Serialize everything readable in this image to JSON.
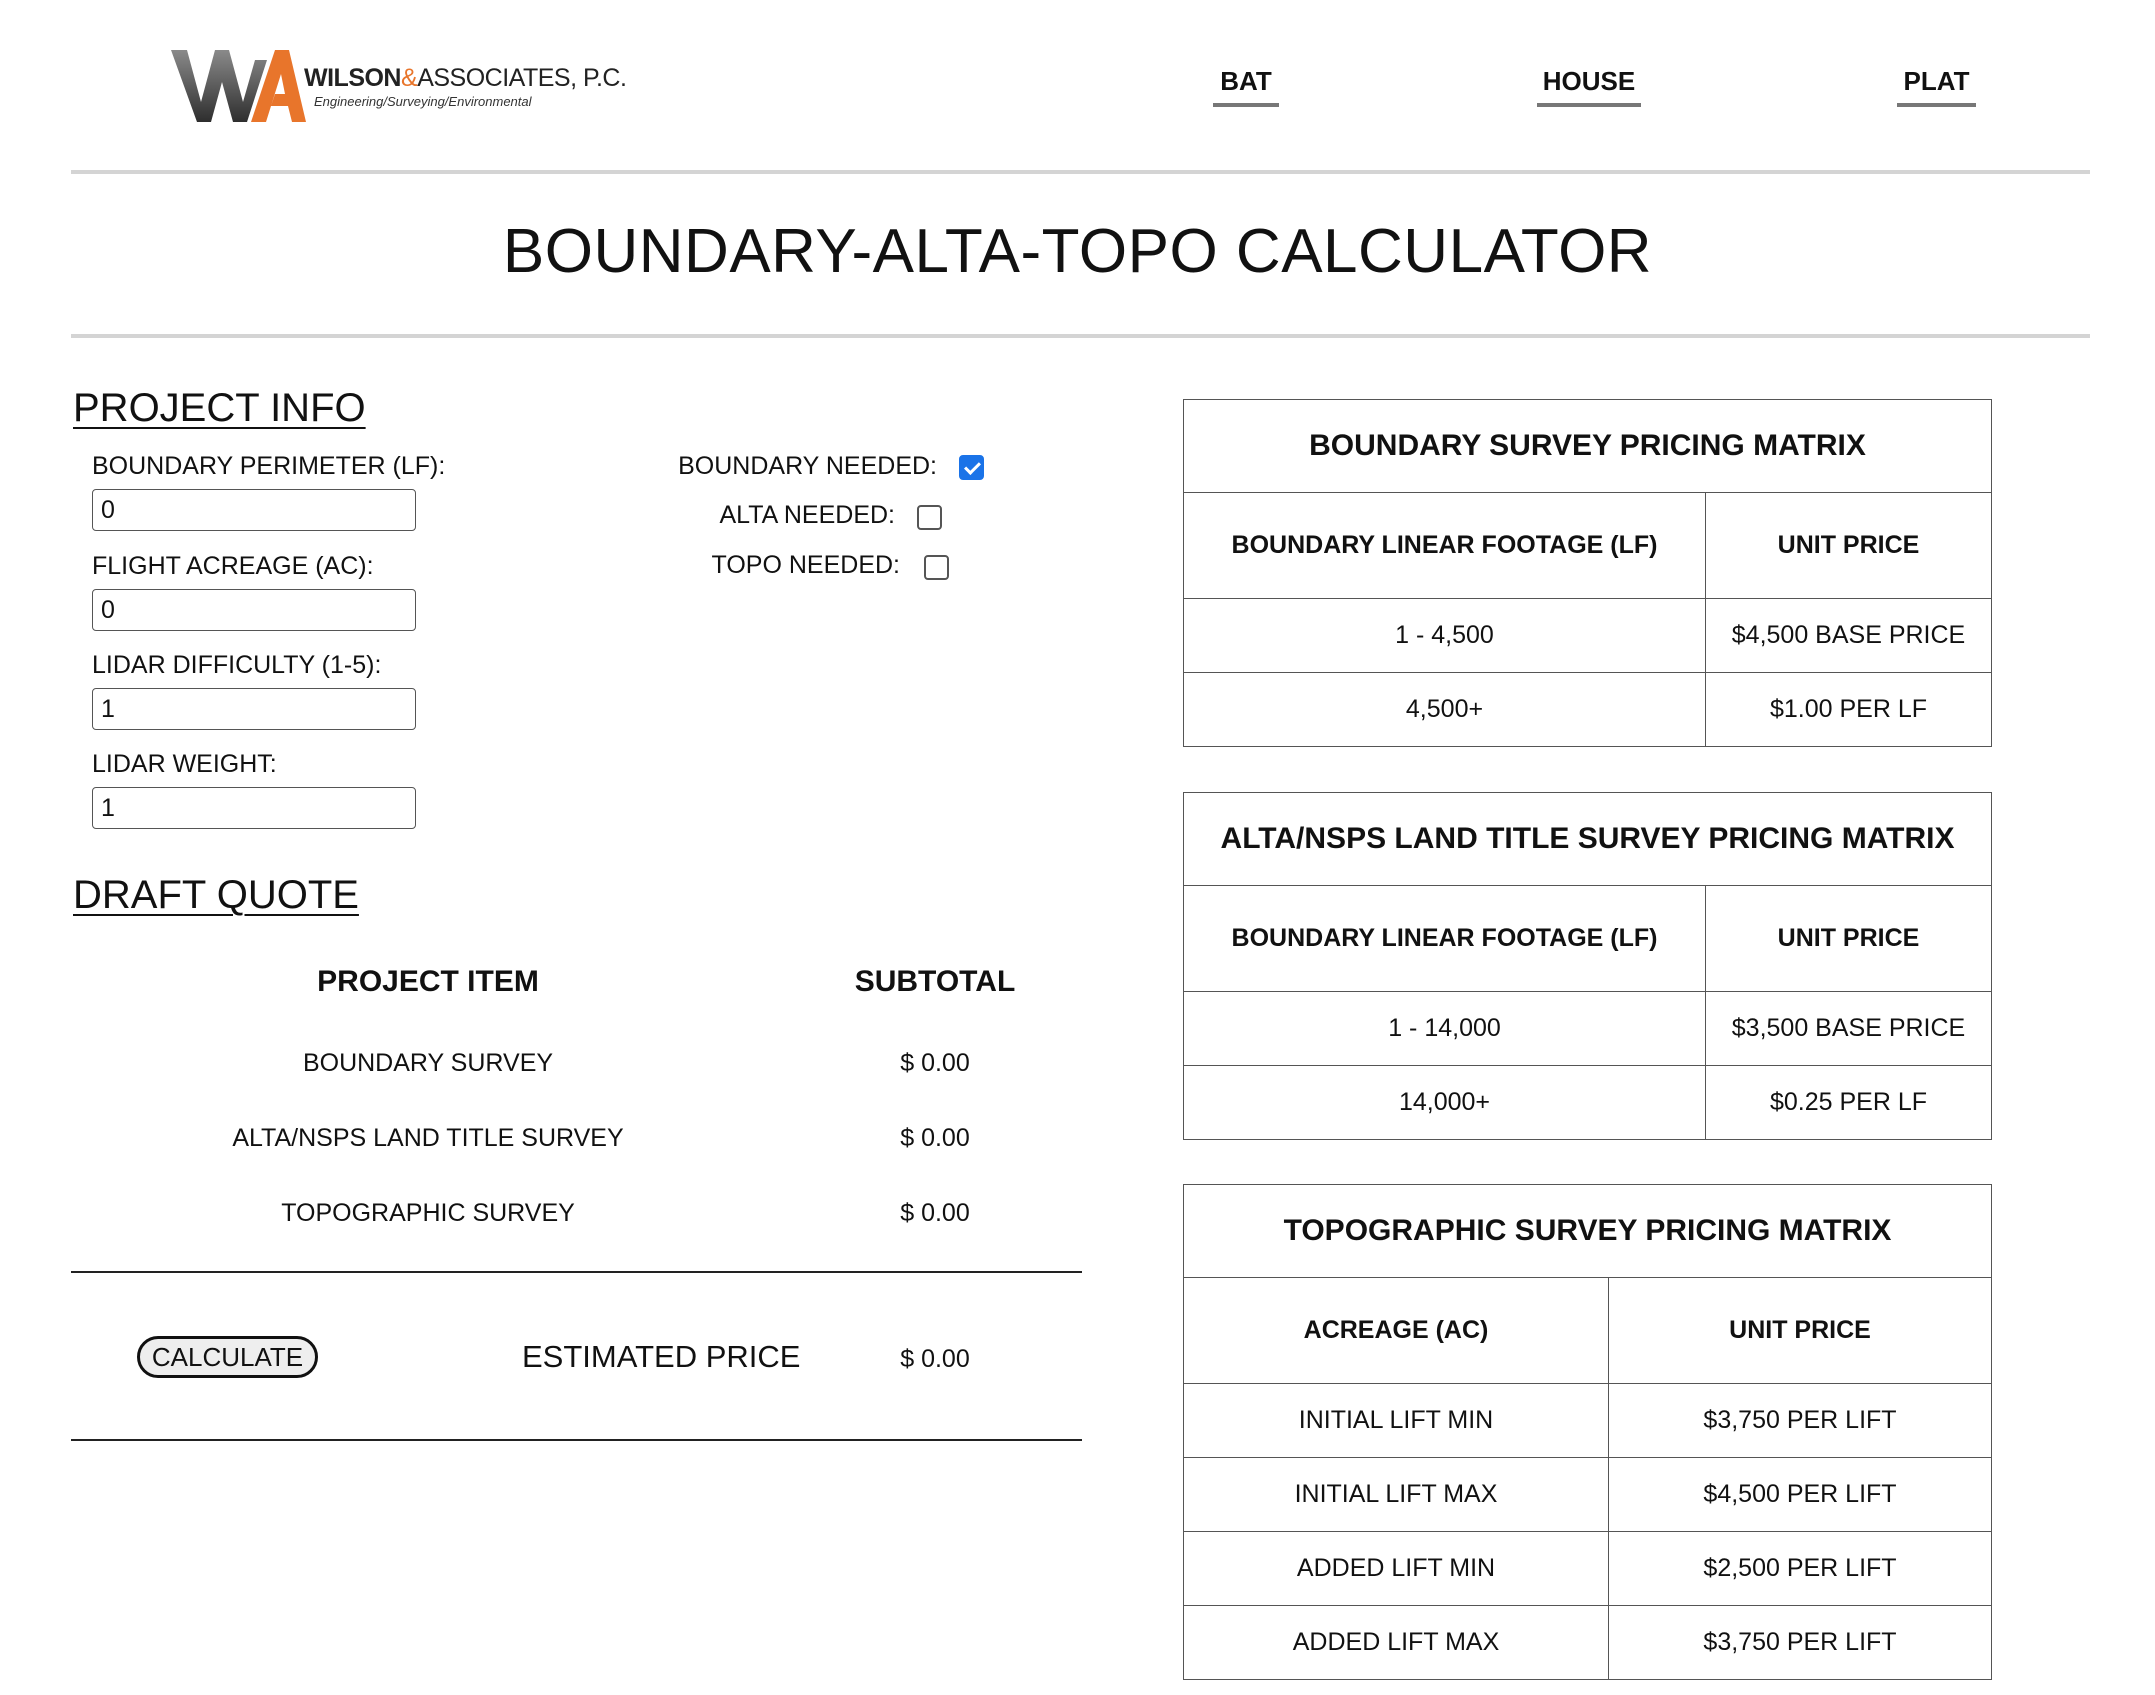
{
  "header": {
    "logo": {
      "name_bold": "WILSON",
      "ampersand": "&",
      "name_rest": "ASSOCIATES, P.C.",
      "tagline": "Engineering/Surveying/Environmental"
    },
    "nav": [
      {
        "label": "BAT"
      },
      {
        "label": "HOUSE"
      },
      {
        "label": "PLAT"
      }
    ]
  },
  "page_title": "BOUNDARY-ALTA-TOPO CALCULATOR",
  "project_info": {
    "heading": "PROJECT INFO",
    "fields": [
      {
        "label": "BOUNDARY PERIMETER (LF):",
        "value": "0"
      },
      {
        "label": "FLIGHT ACREAGE (AC):",
        "value": "0"
      },
      {
        "label": "LIDAR DIFFICULTY (1-5):",
        "value": "1"
      },
      {
        "label": "LIDAR WEIGHT:",
        "value": "1"
      }
    ],
    "checkboxes": [
      {
        "label": "BOUNDARY NEEDED:",
        "checked": true
      },
      {
        "label": "ALTA NEEDED:",
        "checked": false
      },
      {
        "label": "TOPO NEEDED:",
        "checked": false
      }
    ]
  },
  "draft_quote": {
    "heading": "DRAFT QUOTE",
    "col_item": "PROJECT ITEM",
    "col_subtotal": "SUBTOTAL",
    "rows": [
      {
        "item": "BOUNDARY SURVEY",
        "subtotal": "$ 0.00"
      },
      {
        "item": "ALTA/NSPS LAND TITLE SURVEY",
        "subtotal": "$ 0.00"
      },
      {
        "item": "TOPOGRAPHIC SURVEY",
        "subtotal": "$ 0.00"
      }
    ],
    "calculate_label": "CALCULATE",
    "estimated_label": "ESTIMATED PRICE",
    "estimated_value": "$ 0.00"
  },
  "matrices": [
    {
      "title": "BOUNDARY SURVEY PRICING MATRIX",
      "col1": "BOUNDARY LINEAR FOOTAGE (LF)",
      "col2": "UNIT PRICE",
      "rows": [
        [
          "1 - 4,500",
          "$4,500 BASE PRICE"
        ],
        [
          "4,500+",
          "$1.00 PER LF"
        ]
      ]
    },
    {
      "title": "ALTA/NSPS LAND TITLE SURVEY PRICING MATRIX",
      "col1": "BOUNDARY LINEAR FOOTAGE (LF)",
      "col2": "UNIT PRICE",
      "rows": [
        [
          "1 - 14,000",
          "$3,500 BASE PRICE"
        ],
        [
          "14,000+",
          "$0.25 PER LF"
        ]
      ]
    },
    {
      "title": "TOPOGRAPHIC SURVEY PRICING MATRIX",
      "col1": "ACREAGE (AC)",
      "col2": "UNIT PRICE",
      "rows": [
        [
          "INITIAL LIFT MIN",
          "$3,750 PER LIFT"
        ],
        [
          "INITIAL LIFT MAX",
          "$4,500 PER LIFT"
        ],
        [
          "ADDED LIFT MIN",
          "$2,500 PER LIFT"
        ],
        [
          "ADDED LIFT MAX",
          "$3,750 PER LIFT"
        ]
      ]
    }
  ],
  "colors": {
    "logo_gray": "#4a4a4a",
    "logo_orange": "#e8752b",
    "checkbox_blue": "#1a73e8"
  }
}
